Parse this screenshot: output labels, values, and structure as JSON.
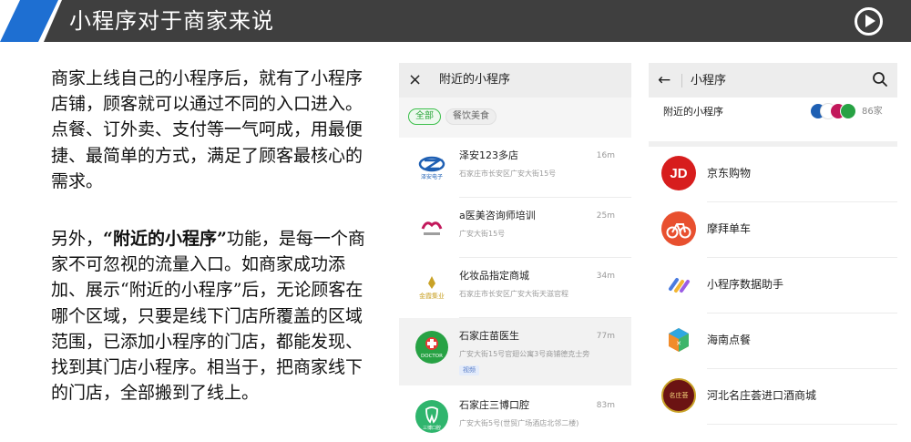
{
  "header": {
    "title": "小程序对于商家来说",
    "play_icon": "play-circle-icon",
    "colors": {
      "bar": "#3f3f3f",
      "accent": "#1e6fd2"
    }
  },
  "left_text": {
    "para1": "商家上线自己的小程序后，就有了小程序店铺，顾客就可以通过不同的入口进入。点餐、订外卖、支付等一气呵成，用最便捷、最简单的方式，满足了顾客最核心的需求。",
    "para2_prefix": "另外，",
    "para2_bold": "“附近的小程序”",
    "para2_suffix": "功能，是每一个商家不可忽视的流量入口。如商家成功添加、展示“附近的小程序”后，无论顾客在哪个区域，只要是线下门店所覆盖的区域范围，已添加小程序的门店，都能发现、找到其门店小程序。相当于，把商家线下的门店，全部搬到了线上。"
  },
  "screen1": {
    "close_icon": "×",
    "title": "附近的小程序",
    "filters": [
      {
        "label": "全部",
        "active": true
      },
      {
        "label": "餐饮美食",
        "active": false
      }
    ],
    "shops": [
      {
        "name": "泽安123多店",
        "distance": "16m",
        "address": "石家庄市长安区广安大街15号",
        "logo_text": "泽安电子"
      },
      {
        "name": "a医美咨询师培训",
        "distance": "25m",
        "address": "广安大街15号",
        "logo_text": ""
      },
      {
        "name": "化妆品指定商城",
        "distance": "34m",
        "address": "石家庄市长安区广安大街天滋官程",
        "logo_text": "金霞集业"
      },
      {
        "name": "石家庄苗医生",
        "distance": "77m",
        "address": "广安大街15号官翅公寓3号商铺德克士旁",
        "logo_text": "DOCTOR",
        "tag": "视频"
      },
      {
        "name": "石家庄三博口腔",
        "distance": "83m",
        "address": "广安大街5号(世贸广场酒店北邻二楼)",
        "logo_text": "三博口腔"
      }
    ]
  },
  "screen2": {
    "back_icon": "←",
    "title": "小程序",
    "nearby_label": "附近的小程序",
    "nearby_count": "86家",
    "apps": [
      {
        "label": "京东购物",
        "icon_text": "JD",
        "color": "#d71d1d"
      },
      {
        "label": "摩拜单车",
        "icon_text": "",
        "color": "#e8502f"
      },
      {
        "label": "小程序数据助手",
        "icon_text": "",
        "color": "#ffffff"
      },
      {
        "label": "海南点餐",
        "icon_text": "",
        "color": "#ffffff"
      },
      {
        "label": "河北名庄荟进口酒商城",
        "icon_text": "名庄荟",
        "color": "#6b1313"
      }
    ]
  }
}
